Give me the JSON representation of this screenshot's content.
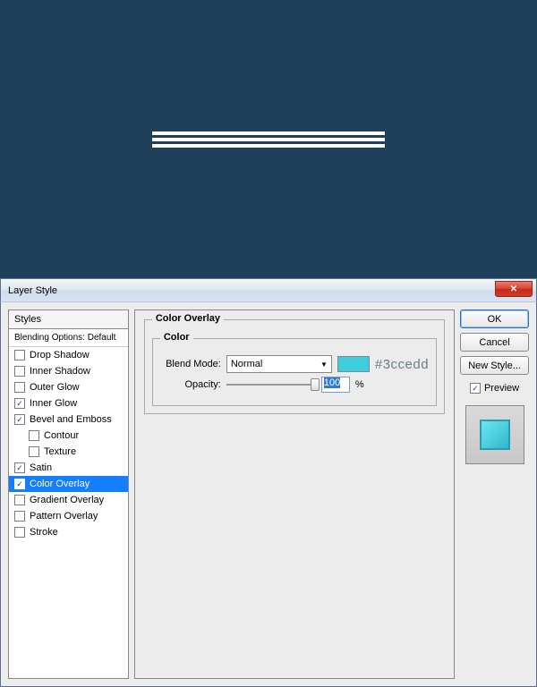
{
  "dialog": {
    "title": "Layer Style"
  },
  "sidebar": {
    "header": "Styles",
    "subheader": "Blending Options: Default",
    "items": [
      {
        "label": "Drop Shadow",
        "checked": false,
        "indent": false
      },
      {
        "label": "Inner Shadow",
        "checked": false,
        "indent": false
      },
      {
        "label": "Outer Glow",
        "checked": false,
        "indent": false
      },
      {
        "label": "Inner Glow",
        "checked": true,
        "indent": false
      },
      {
        "label": "Bevel and Emboss",
        "checked": true,
        "indent": false
      },
      {
        "label": "Contour",
        "checked": false,
        "indent": true
      },
      {
        "label": "Texture",
        "checked": false,
        "indent": true
      },
      {
        "label": "Satin",
        "checked": true,
        "indent": false
      },
      {
        "label": "Color Overlay",
        "checked": true,
        "indent": false,
        "selected": true
      },
      {
        "label": "Gradient Overlay",
        "checked": false,
        "indent": false
      },
      {
        "label": "Pattern Overlay",
        "checked": false,
        "indent": false
      },
      {
        "label": "Stroke",
        "checked": false,
        "indent": false
      }
    ]
  },
  "main": {
    "panel_title": "Color Overlay",
    "section_title": "Color",
    "blend_mode_label": "Blend Mode:",
    "blend_mode_value": "Normal",
    "color_hex": "#3ccedd",
    "opacity_label": "Opacity:",
    "opacity_value": "100",
    "opacity_unit": "%"
  },
  "buttons": {
    "ok": "OK",
    "cancel": "Cancel",
    "new_style": "New Style...",
    "preview_label": "Preview",
    "preview_checked": true
  }
}
